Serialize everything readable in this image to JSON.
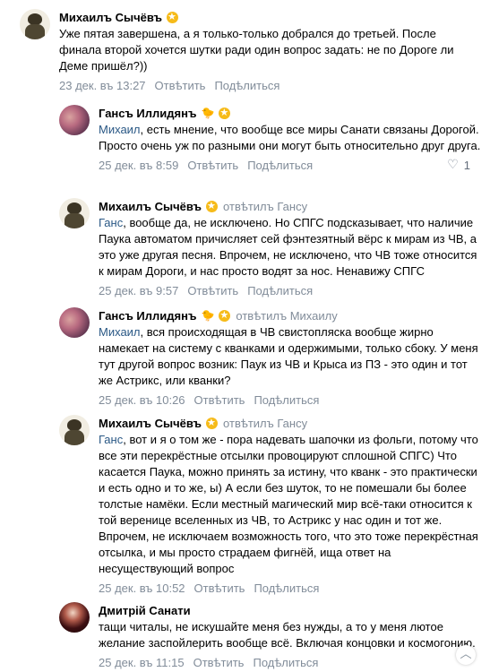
{
  "comments": [
    {
      "author": "Михаилъ Сычёвъ",
      "badge": "star-badge",
      "reply_to": "",
      "mention": "",
      "text": "Уже пятая завершена, а я только-только добрался до третьей. После финала второй хочется шутки ради один вопрос задать: не по Дороге ли Деме пришёл?))",
      "date": "23 дек. въ 13:27",
      "reply_label": "Отвѣтить",
      "share_label": "Подѣлиться",
      "likes": ""
    },
    {
      "author": "Гансъ Иллидянъ",
      "badge": "star-badge",
      "emoji": "🐤",
      "reply_to": "",
      "mention": "Михаил",
      "text": ", есть мнение, что вообще все миры Санати связаны Дорогой. Просто очень уж по разными они могут быть относительно друг друга.",
      "date": "25 дек. въ 8:59",
      "reply_label": "Отвѣтить",
      "share_label": "Подѣлиться",
      "likes": "1"
    },
    {
      "author": "Михаилъ Сычёвъ",
      "badge": "star-badge",
      "reply_to": "отвѣтилъ Гансу",
      "mention": "Ганс",
      "text": ", вообще да, не исключено. Но СПГС подсказывает, что наличие Паука автоматом причисляет сей фэнтезятный вёрс к мирам из ЧВ, а это уже другая песня. Впрочем, не исключено, что ЧВ тоже относится к мирам Дороги, и нас просто водят за нос. Ненавижу СПГС",
      "date": "25 дек. въ 9:57",
      "reply_label": "Отвѣтить",
      "share_label": "Подѣлиться",
      "likes": ""
    },
    {
      "author": "Гансъ Иллидянъ",
      "badge": "star-badge",
      "emoji": "🐤",
      "reply_to": "отвѣтилъ Михаилу",
      "mention": "Михаил",
      "text": ", вся происходящая в ЧВ свистопляска вообще жирно намекает на систему с кванками и одержимыми, только сбоку. У меня тут другой вопрос возник: Паук из ЧВ и Крыса из ПЗ - это один и тот же Астрикс, или кванки?",
      "date": "25 дек. въ 10:26",
      "reply_label": "Отвѣтить",
      "share_label": "Подѣлиться",
      "likes": ""
    },
    {
      "author": "Михаилъ Сычёвъ",
      "badge": "star-badge",
      "reply_to": "отвѣтилъ Гансу",
      "mention": "Ганс",
      "text": ", вот и я о том же - пора надевать шапочки из фольги, потому что все эти перекрёстные отсылки провоцируют сплошной СПГС) Что касается Паука, можно принять за истину, что кванк - это практически и есть одно и то же, ы) А если без шуток, то не помешали бы более толстые намёки. Если местный магический мир всё-таки относится к той веренице вселенных из ЧВ, то Астрикс у нас один и тот же. Впрочем, не исключаем возможность того, что это тоже перекрёстная отсылка, и мы просто страдаем фигнёй, ища ответ на несуществующий вопрос",
      "date": "25 дек. въ 10:52",
      "reply_label": "Отвѣтить",
      "share_label": "Подѣлиться",
      "likes": ""
    },
    {
      "author": "Дмитрій Санати",
      "badge": "",
      "reply_to": "",
      "mention": "",
      "text": "тащи читалы, не искушайте меня без нужды, а то у меня лютое желание заспойлерить вообще всё. Включая концовки и космогонию.",
      "date": "25 дек. въ 11:15",
      "reply_label": "Отвѣтить",
      "share_label": "Подѣлиться",
      "likes": ""
    }
  ],
  "icons": {
    "badge": "star-badge",
    "like": "heart-icon",
    "scroll": "chevron-up-icon"
  },
  "colors": {
    "link": "#2a5885",
    "meta": "#818c99",
    "badge": "#f6bb1a"
  }
}
